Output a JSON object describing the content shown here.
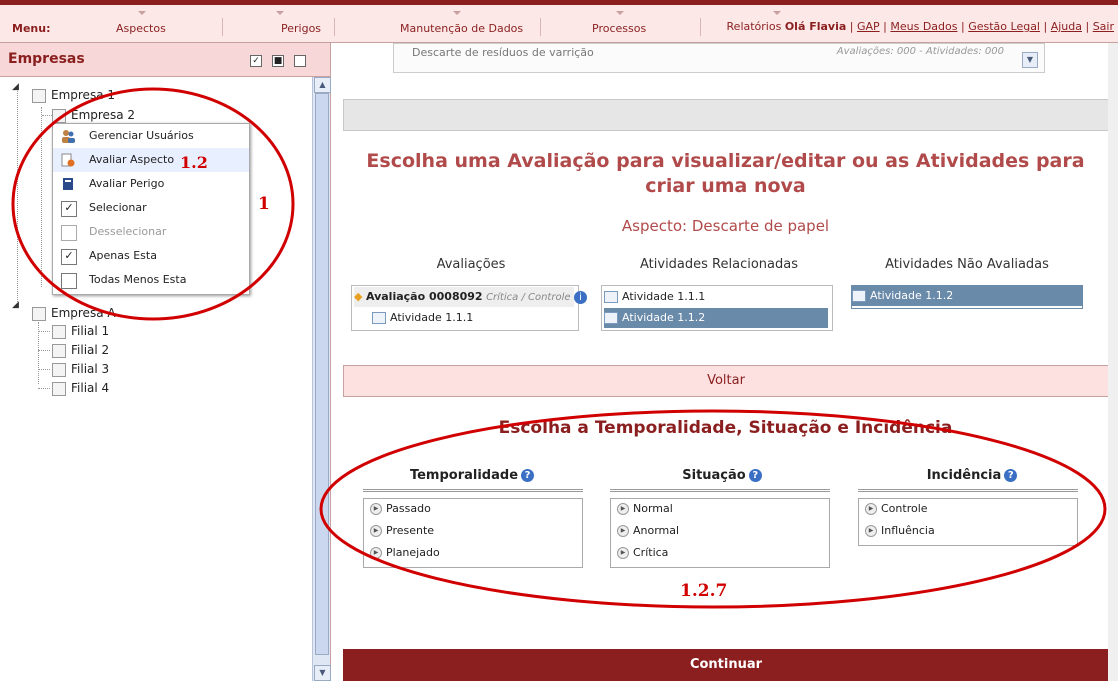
{
  "topbar": {
    "menu_label": "Menu:",
    "items": [
      "Aspectos",
      "Perigos",
      "Manutenção de Dados",
      "Processos",
      "Relatórios"
    ],
    "user": "Olá Flavia",
    "links": [
      "GAP",
      "Meus Dados",
      "Gestão Legal",
      "Ajuda",
      "Sair"
    ]
  },
  "sidebar": {
    "title": "Empresas",
    "tree": {
      "empresa1": "Empresa 1",
      "empresa2": "Empresa 2",
      "empresaA": "Empresa A",
      "filiais": [
        "Filial 1",
        "Filial 2",
        "Filial 3",
        "Filial 4"
      ]
    }
  },
  "context_menu": {
    "items": [
      {
        "label": "Gerenciar Usuários",
        "icon": "users-icon"
      },
      {
        "label": "Avaliar Aspecto",
        "icon": "document-add-icon"
      },
      {
        "label": "Avaliar Perigo",
        "icon": "book-icon"
      },
      {
        "label": "Selecionar",
        "icon": "checked-box-icon"
      },
      {
        "label": "Desselecionar",
        "icon": "empty-box-icon"
      },
      {
        "label": "Apenas Esta",
        "icon": "checked-box-icon"
      },
      {
        "label": "Todas Menos Esta",
        "icon": "empty-box-icon"
      }
    ]
  },
  "main": {
    "top_dropdown": {
      "value": "Descarte de resíduos de varrição",
      "meta": "Avaliações: 000 - Atividades: 000"
    },
    "heading": "Escolha uma Avaliação para visualizar/editar ou as Atividades para criar uma nova",
    "aspect": "Aspecto: Descarte de papel",
    "columns": {
      "avaliacoes": {
        "title": "Avaliações",
        "item": "Avaliação 0008092",
        "item_meta": "Crítica / Controle",
        "child": "Atividade 1.1.1"
      },
      "relacionadas": {
        "title": "Atividades Relacionadas",
        "items": [
          "Atividade 1.1.1",
          "Atividade 1.1.2"
        ]
      },
      "nao_avaliadas": {
        "title": "Atividades Não Avaliadas",
        "items": [
          "Atividade 1.1.2"
        ]
      }
    },
    "voltar": "Voltar",
    "section_heading": "Escolha a Temporalidade, Situação e Incidência",
    "temporalidade": {
      "title": "Temporalidade",
      "options": [
        "Passado",
        "Presente",
        "Planejado"
      ]
    },
    "situacao": {
      "title": "Situação",
      "options": [
        "Normal",
        "Anormal",
        "Crítica"
      ]
    },
    "incidencia": {
      "title": "Incidência",
      "options": [
        "Controle",
        "Influência"
      ]
    },
    "continuar": "Continuar"
  },
  "annotations": {
    "a1": "1",
    "a12": "1.2",
    "a127": "1.2.7",
    "color": "#d10000"
  },
  "help_icon_glyph": "?"
}
